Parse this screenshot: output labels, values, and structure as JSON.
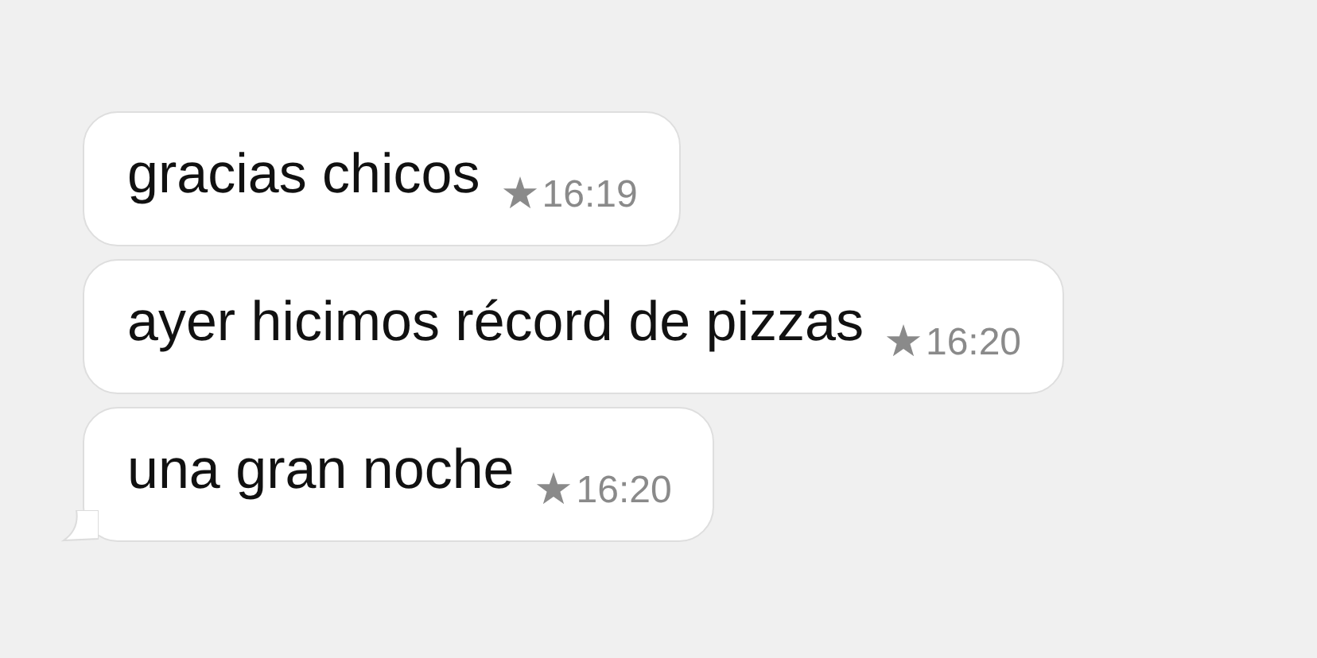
{
  "messages": [
    {
      "text": "gracias chicos",
      "time": "16:19",
      "starred": true,
      "tail": false
    },
    {
      "text": "ayer hicimos récord de pizzas",
      "time": "16:20",
      "starred": true,
      "tail": false
    },
    {
      "text": "una gran noche",
      "time": "16:20",
      "starred": true,
      "tail": true
    }
  ]
}
